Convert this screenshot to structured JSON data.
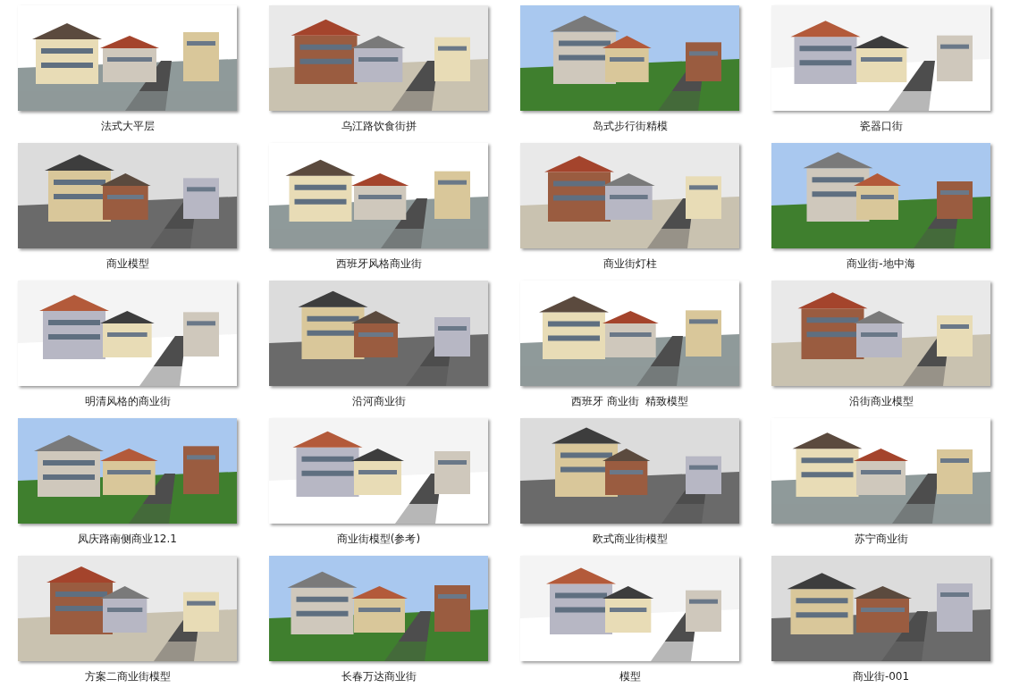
{
  "files": [
    {
      "name": "法式大平层"
    },
    {
      "name": "乌江路饮食街拼"
    },
    {
      "name": "岛式步行街精模"
    },
    {
      "name": "瓷器口街"
    },
    {
      "name": "商业模型"
    },
    {
      "name": "西班牙风格商业街"
    },
    {
      "name": "商业街灯柱"
    },
    {
      "name": "商业街-地中海"
    },
    {
      "name": "明清风格的商业街"
    },
    {
      "name": "沿河商业街"
    },
    {
      "name": "西班牙 商业街  精致模型"
    },
    {
      "name": "沿街商业模型"
    },
    {
      "name": "凤庆路南侧商业12.1"
    },
    {
      "name": "商业街模型(参考)"
    },
    {
      "name": "欧式商业街模型"
    },
    {
      "name": "苏宁商业街"
    },
    {
      "name": "方案二商业街模型"
    },
    {
      "name": "长春万达商业街"
    },
    {
      "name": "模型"
    },
    {
      "name": "商业街-001"
    }
  ]
}
